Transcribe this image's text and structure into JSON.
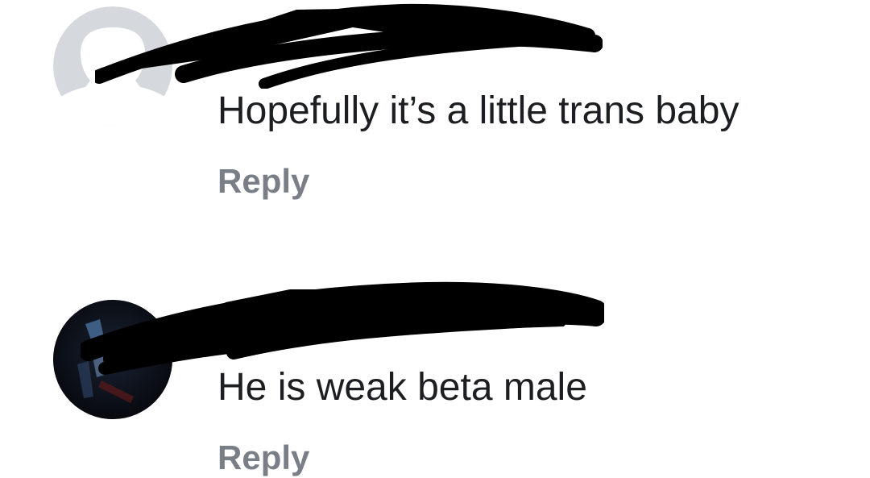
{
  "comments": [
    {
      "author_name": "",
      "avatar_icon": "default-profile-silhouette-icon",
      "text": "Hopefully it’s a little trans baby",
      "reply_label": "Reply"
    },
    {
      "author_name": "",
      "avatar_icon": "dark-profile-photo-icon",
      "text": "He is weak beta male",
      "reply_label": "Reply"
    }
  ],
  "colors": {
    "text": "#1c1e21",
    "reply": "#7a7f87",
    "default_avatar": "#d5d8dc",
    "redaction": "#000000"
  }
}
